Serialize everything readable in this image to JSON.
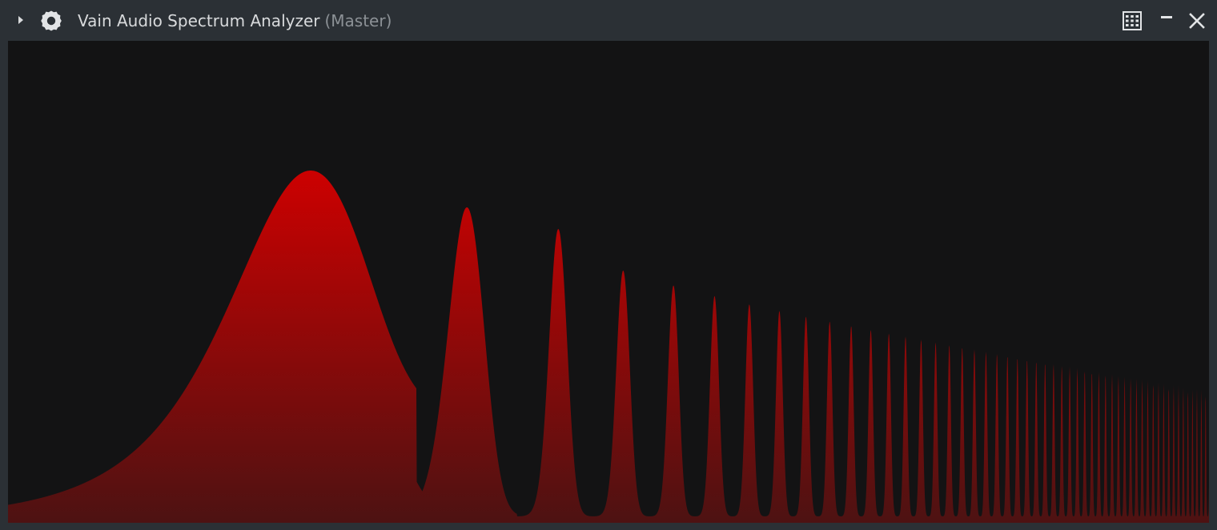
{
  "window": {
    "title": "Vain Audio Spectrum Analyzer",
    "subtitle": "(Master)"
  },
  "icons": {
    "expand": "caret-right-icon",
    "settings": "gear-icon",
    "grid": "grid-icon",
    "minimize": "minimize-icon",
    "close": "close-icon"
  },
  "colors": {
    "titlebar_bg": "#2b3035",
    "plot_bg": "#131314",
    "spectrum_top": "#d00000",
    "spectrum_bottom": "#4d1212"
  }
}
